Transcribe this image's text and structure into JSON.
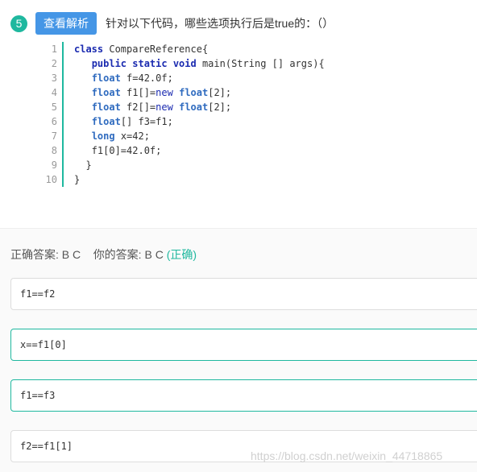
{
  "question": {
    "number": "5",
    "analysis_button": "查看解析",
    "text": "针对以下代码，哪些选项执行后是true的：（）"
  },
  "code": {
    "line_numbers": [
      "1",
      "2",
      "3",
      "4",
      "5",
      "6",
      "7",
      "8",
      "9",
      "10"
    ],
    "lines": [
      "class CompareReference{",
      "  public static void main(String [] args){",
      "  float f=42.0f;",
      "  float f1[]=new float[2];",
      "  float f2[]=new float[2];",
      "  float[] f3=f1;",
      "  long x=42;",
      "  f1[0]=42.0f;",
      " }",
      "}"
    ]
  },
  "answer": {
    "correct_label": "正确答案: B C",
    "your_label": "你的答案: B C",
    "status": "(正确)"
  },
  "options": [
    {
      "text": "f1==f2",
      "selected": false
    },
    {
      "text": "x==f1[0]",
      "selected": true
    },
    {
      "text": "f1==f3",
      "selected": true
    },
    {
      "text": "f2==f1[1]",
      "selected": false
    }
  ],
  "watermark": "https://blog.csdn.net/weixin_44718865",
  "colors": {
    "accent": "#1fb89f",
    "button_blue": "#4596e6"
  }
}
